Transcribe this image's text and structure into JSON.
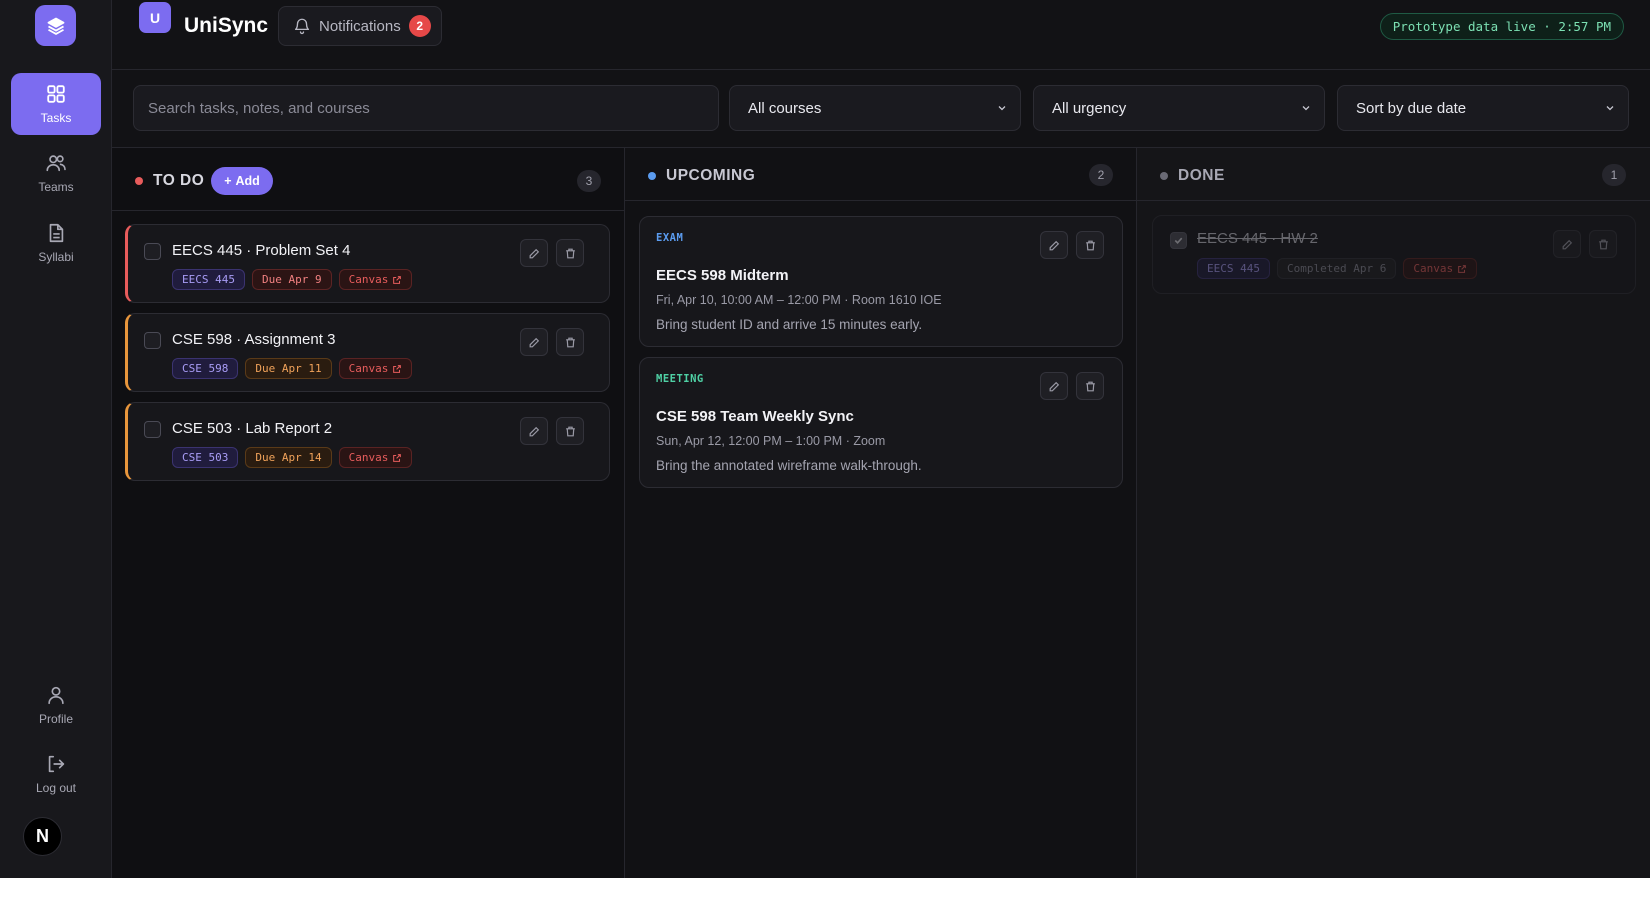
{
  "app": {
    "title": "UniSync",
    "badge_letter": "U",
    "accent": "#7c6cf0"
  },
  "header": {
    "notifications_label": "Notifications",
    "notifications_count": "2",
    "live_status": "Prototype data live · 2:57 PM"
  },
  "sidebar": {
    "items": [
      {
        "label": "Tasks",
        "icon": "grid-icon",
        "active": true
      },
      {
        "label": "Teams",
        "icon": "users-icon",
        "active": false
      },
      {
        "label": "Syllabi",
        "icon": "document-icon",
        "active": false
      }
    ],
    "bottom": [
      {
        "label": "Profile",
        "icon": "user-icon"
      },
      {
        "label": "Log out",
        "icon": "logout-icon"
      }
    ],
    "avatar_letter": "N"
  },
  "filters": {
    "search_placeholder": "Search tasks, notes, and courses",
    "course": "All courses",
    "urgency": "All urgency",
    "sort": "Sort by due date"
  },
  "columns": {
    "todo": {
      "title": "TO DO",
      "count": "3",
      "add_label": "Add",
      "dot_color": "#e85c5c",
      "tasks": [
        {
          "title": "EECS 445 · Problem Set 4",
          "course": "EECS 445",
          "due": "Due Apr 9",
          "link": "Canvas",
          "urgency": "high"
        },
        {
          "title": "CSE 598 · Assignment 3",
          "course": "CSE 598",
          "due": "Due Apr 11",
          "link": "Canvas",
          "urgency": "medium"
        },
        {
          "title": "CSE 503 · Lab Report 2",
          "course": "CSE 503",
          "due": "Due Apr 14",
          "link": "Canvas",
          "urgency": "medium"
        }
      ]
    },
    "upcoming": {
      "title": "UPCOMING",
      "count": "2",
      "dot_color": "#5b9cf0",
      "events": [
        {
          "type": "EXAM",
          "title": "EECS 598 Midterm",
          "meta": "Fri, Apr 10, 10:00 AM – 12:00 PM · Room 1610 IOE",
          "note": "Bring student ID and arrive 15 minutes early.",
          "type_color": "#5b9cf0"
        },
        {
          "type": "MEETING",
          "title": "CSE 598 Team Weekly Sync",
          "meta": "Sun, Apr 12, 12:00 PM – 1:00 PM · Zoom",
          "note": "Bring the annotated wireframe walk-through.",
          "type_color": "#4fd1a5"
        }
      ]
    },
    "done": {
      "title": "DONE",
      "count": "1",
      "dot_color": "#6a6a75",
      "tasks": [
        {
          "title": "EECS 445 · HW 2",
          "course": "EECS 445",
          "completed": "Completed Apr 6",
          "link": "Canvas"
        }
      ]
    }
  }
}
